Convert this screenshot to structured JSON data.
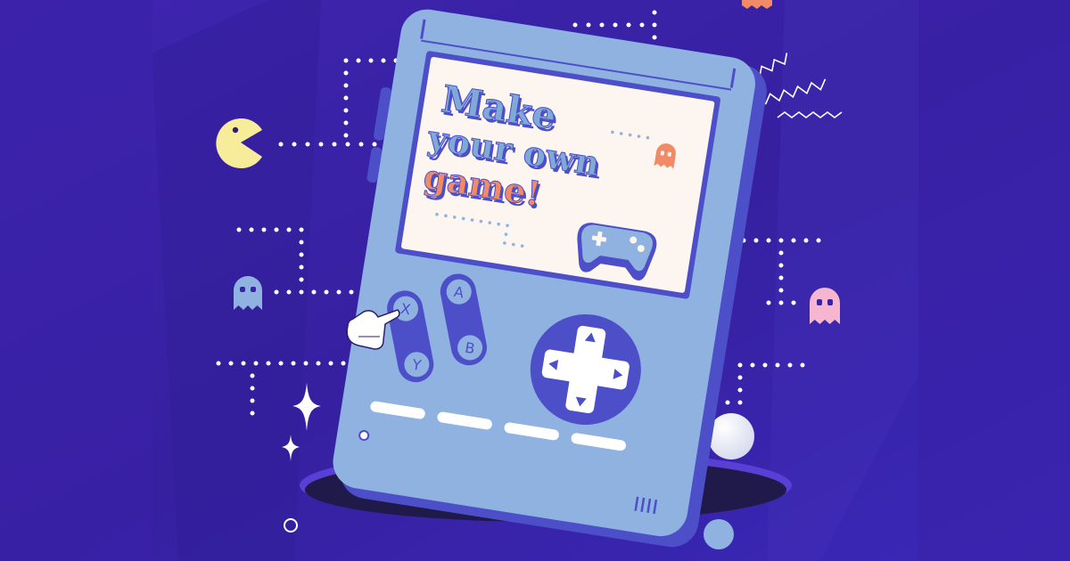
{
  "screen": {
    "title_lines": [
      "Make",
      "your own",
      "game!"
    ],
    "colors": {
      "title_primary": "#7fa9d6",
      "title_accent": "#f08a67",
      "background": "#3a22a8",
      "console_body": "#8fb2e0",
      "console_edge": "#4d4fc8"
    }
  },
  "buttons": {
    "x_label": "X",
    "y_label": "Y",
    "a_label": "A",
    "b_label": "B"
  },
  "decor": {
    "pacman_icon": "pacman-icon",
    "ghost_left": "ghost-icon",
    "ghost_right": "ghost-icon",
    "ghost_top": "ghost-icon",
    "gamepad_icon": "gamepad-icon",
    "sparkle_icon": "sparkle-icon",
    "dpad_icon": "dpad-icon"
  }
}
